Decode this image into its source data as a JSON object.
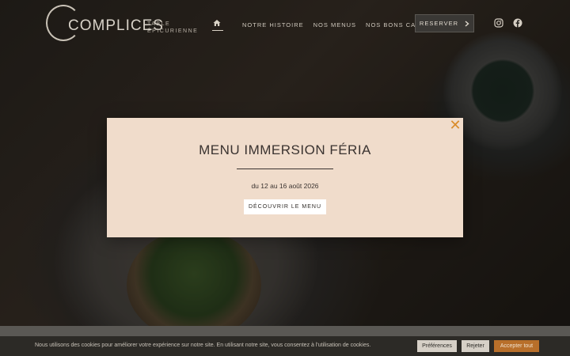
{
  "brand": {
    "logo_text": "COMPLICES",
    "tagline_line1": "TABLE",
    "tagline_line2": "ÉPICURIENNE"
  },
  "nav": {
    "home_icon": "home-icon",
    "items": [
      {
        "label": "NOTRE HISTOIRE"
      },
      {
        "label": "NOS MENUS"
      },
      {
        "label": "NOS BONS CADEAUX"
      }
    ],
    "reserve_label": "RESERVER",
    "social": [
      "instagram-icon",
      "facebook-icon"
    ]
  },
  "modal": {
    "title": "MENU IMMERSION FÉRIA",
    "date": "du 12 au 16 août 2026",
    "cta_label": "DÉCOUVRIR LE MENU",
    "close_glyph": "✕"
  },
  "cookie": {
    "text": "Nous utilisons des cookies pour améliorer votre expérience sur notre site. En utilisant notre site, vous consentez à l'utilisation de cookies.",
    "preferences_label": "Préférences",
    "reject_label": "Rejeter",
    "accept_label": "Accepter tout"
  },
  "colors": {
    "modal_bg": "#f0dccb",
    "accent": "#d98c2a",
    "accept_button": "#b86f2a"
  }
}
